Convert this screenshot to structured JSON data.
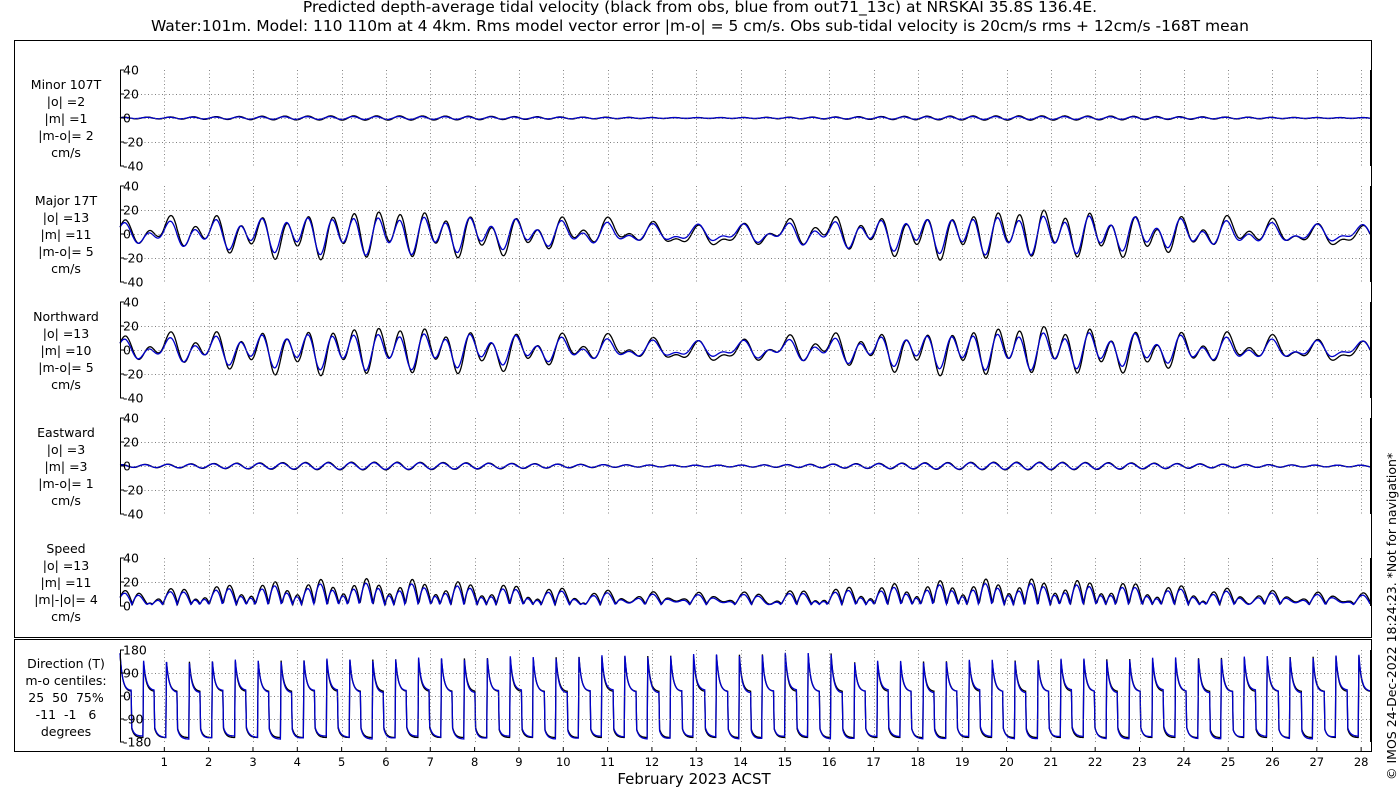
{
  "title": {
    "line1": "Predicted depth-average tidal velocity (black from obs, blue from out71_13c) at NRSKAI 35.8S 136.4E.",
    "line2": "Water:101m. Model: 110 110m at 4 4km. Rms model vector error |m-o| = 5 cm/s. Obs sub-tidal velocity is 20cm/s rms + 12cm/s -168T mean"
  },
  "watermark": "© IMOS 24-Dec-2022 18:24:23. *Not for navigation*",
  "xaxis": {
    "label": "February 2023 ACST",
    "ticks": [
      "1",
      "2",
      "3",
      "4",
      "5",
      "6",
      "7",
      "8",
      "9",
      "10",
      "11",
      "12",
      "13",
      "14",
      "15",
      "16",
      "17",
      "18",
      "19",
      "20",
      "21",
      "22",
      "23",
      "24",
      "25",
      "26",
      "27",
      "28"
    ]
  },
  "colors": {
    "obs": "#000000",
    "model": "#0000cc"
  },
  "panels": [
    {
      "id": "minor",
      "label_lines": [
        "Minor 107T",
        "|o| =2",
        "|m| =1",
        "|m-o|= 2",
        "cm/s"
      ],
      "yticks": [
        "40",
        "20",
        "0",
        "-20",
        "-40"
      ]
    },
    {
      "id": "major",
      "label_lines": [
        "Major 17T",
        "|o| =13",
        "|m| =11",
        "|m-o|= 5",
        "cm/s"
      ],
      "yticks": [
        "40",
        "20",
        "0",
        "-20",
        "-40"
      ]
    },
    {
      "id": "north",
      "label_lines": [
        "Northward",
        "|o| =13",
        "|m| =10",
        "|m-o|= 5",
        "cm/s"
      ],
      "yticks": [
        "40",
        "20",
        "0",
        "-20",
        "-40"
      ]
    },
    {
      "id": "east",
      "label_lines": [
        "Eastward",
        "|o| =3",
        "|m| =3",
        "|m-o|= 1",
        "cm/s"
      ],
      "yticks": [
        "40",
        "20",
        "0",
        "-20",
        "-40"
      ]
    },
    {
      "id": "speed",
      "label_lines": [
        "Speed",
        "|o| =13",
        "|m| =11",
        "|m|-|o|= 4",
        "cm/s"
      ],
      "yticks": [
        "40",
        "20",
        "0"
      ]
    },
    {
      "id": "direction",
      "label_lines": [
        "Direction (T)",
        "m-o centiles:",
        "25  50  75%",
        "-11  -1   6",
        "degrees"
      ],
      "yticks": [
        "180",
        "90",
        "0",
        "-90",
        "-180"
      ]
    }
  ],
  "chart_data": {
    "type": "line",
    "xlabel": "February 2023 ACST",
    "x_range": [
      0,
      28.2
    ],
    "series": [
      {
        "name": "obs",
        "color": "#000000"
      },
      {
        "name": "out71_13c",
        "color": "#0000cc"
      }
    ],
    "panels": [
      {
        "name": "Minor 107T",
        "ylim": [
          -40,
          40
        ],
        "obs_amplitude": 2,
        "model_amplitude": 1,
        "rms_error": 2
      },
      {
        "name": "Major 17T",
        "ylim": [
          -40,
          40
        ],
        "obs_amplitude": 13,
        "model_amplitude": 11,
        "rms_error": 5
      },
      {
        "name": "Northward",
        "ylim": [
          -40,
          40
        ],
        "obs_amplitude": 13,
        "model_amplitude": 10,
        "rms_error": 5
      },
      {
        "name": "Eastward",
        "ylim": [
          -40,
          40
        ],
        "obs_amplitude": 3,
        "model_amplitude": 3,
        "rms_error": 1
      },
      {
        "name": "Speed",
        "ylim": [
          0,
          40
        ],
        "obs_amplitude": 13,
        "model_amplitude": 11,
        "speed_difference": 4
      },
      {
        "name": "Direction (T)",
        "ylim": [
          -180,
          180
        ],
        "centiles": [
          25,
          50,
          75
        ],
        "centile_values_deg": [
          -11,
          -1,
          6
        ]
      }
    ]
  }
}
